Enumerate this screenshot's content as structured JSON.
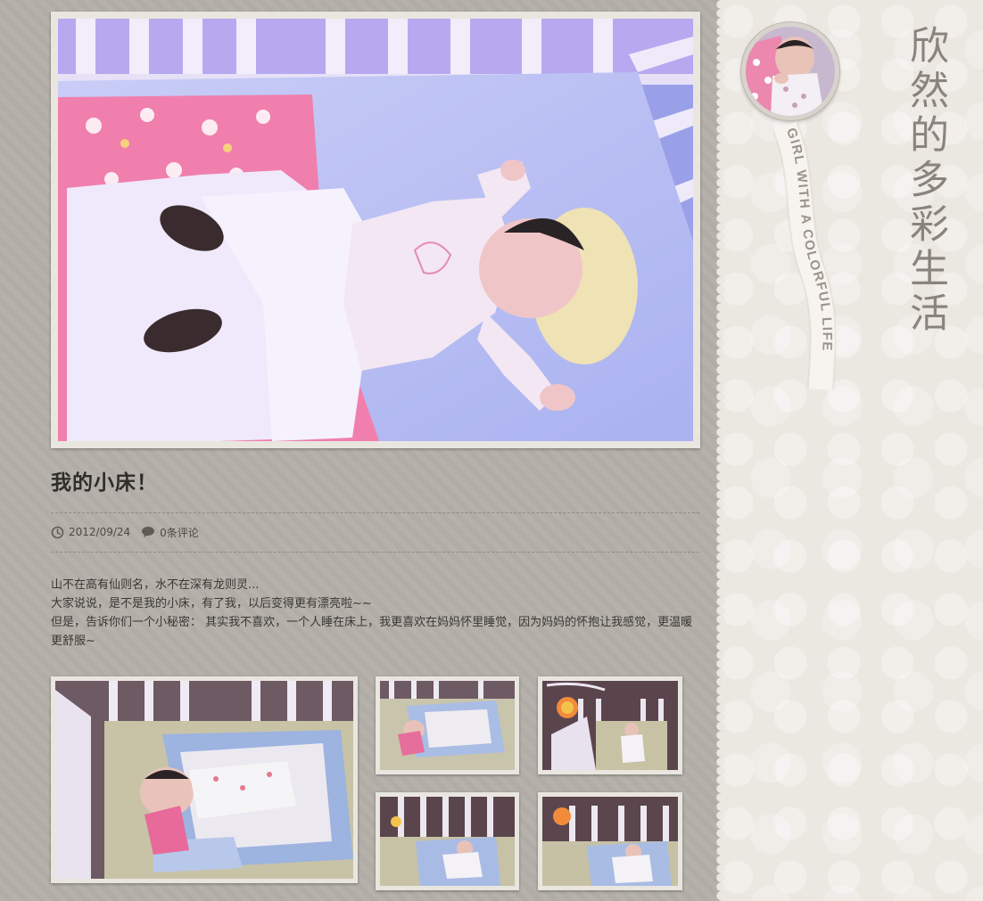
{
  "site": {
    "blog_title": "欣然的多彩生活",
    "subtitle_ribbon": "GIRL WITH A COLORFUL LIFE"
  },
  "post": {
    "title": "我的小床！",
    "date": "2012/09/24",
    "comments": "0条评论",
    "date_icon": "clock-icon",
    "comments_icon": "speech-bubble-icon",
    "body": [
      "山不在高有仙则名，水不在深有龙则灵...",
      "大家说说，是不是我的小床，有了我，以后变得更有漂亮啦~~",
      "但是，告诉你们一个小秘密： 其实我不喜欢，一个人睡在床上，我更喜欢在妈妈怀里睡觉，因为妈妈的怀抱让我感觉，更温暖更舒服~"
    ]
  },
  "gallery": {
    "photo_count": 5
  },
  "colors": {
    "main_bg": "#b4b0a9",
    "sidebar_bg": "#ebe7e1",
    "title_text": "#2f2d2a",
    "body_text": "#3a3733",
    "brand_text": "#8a847c"
  }
}
